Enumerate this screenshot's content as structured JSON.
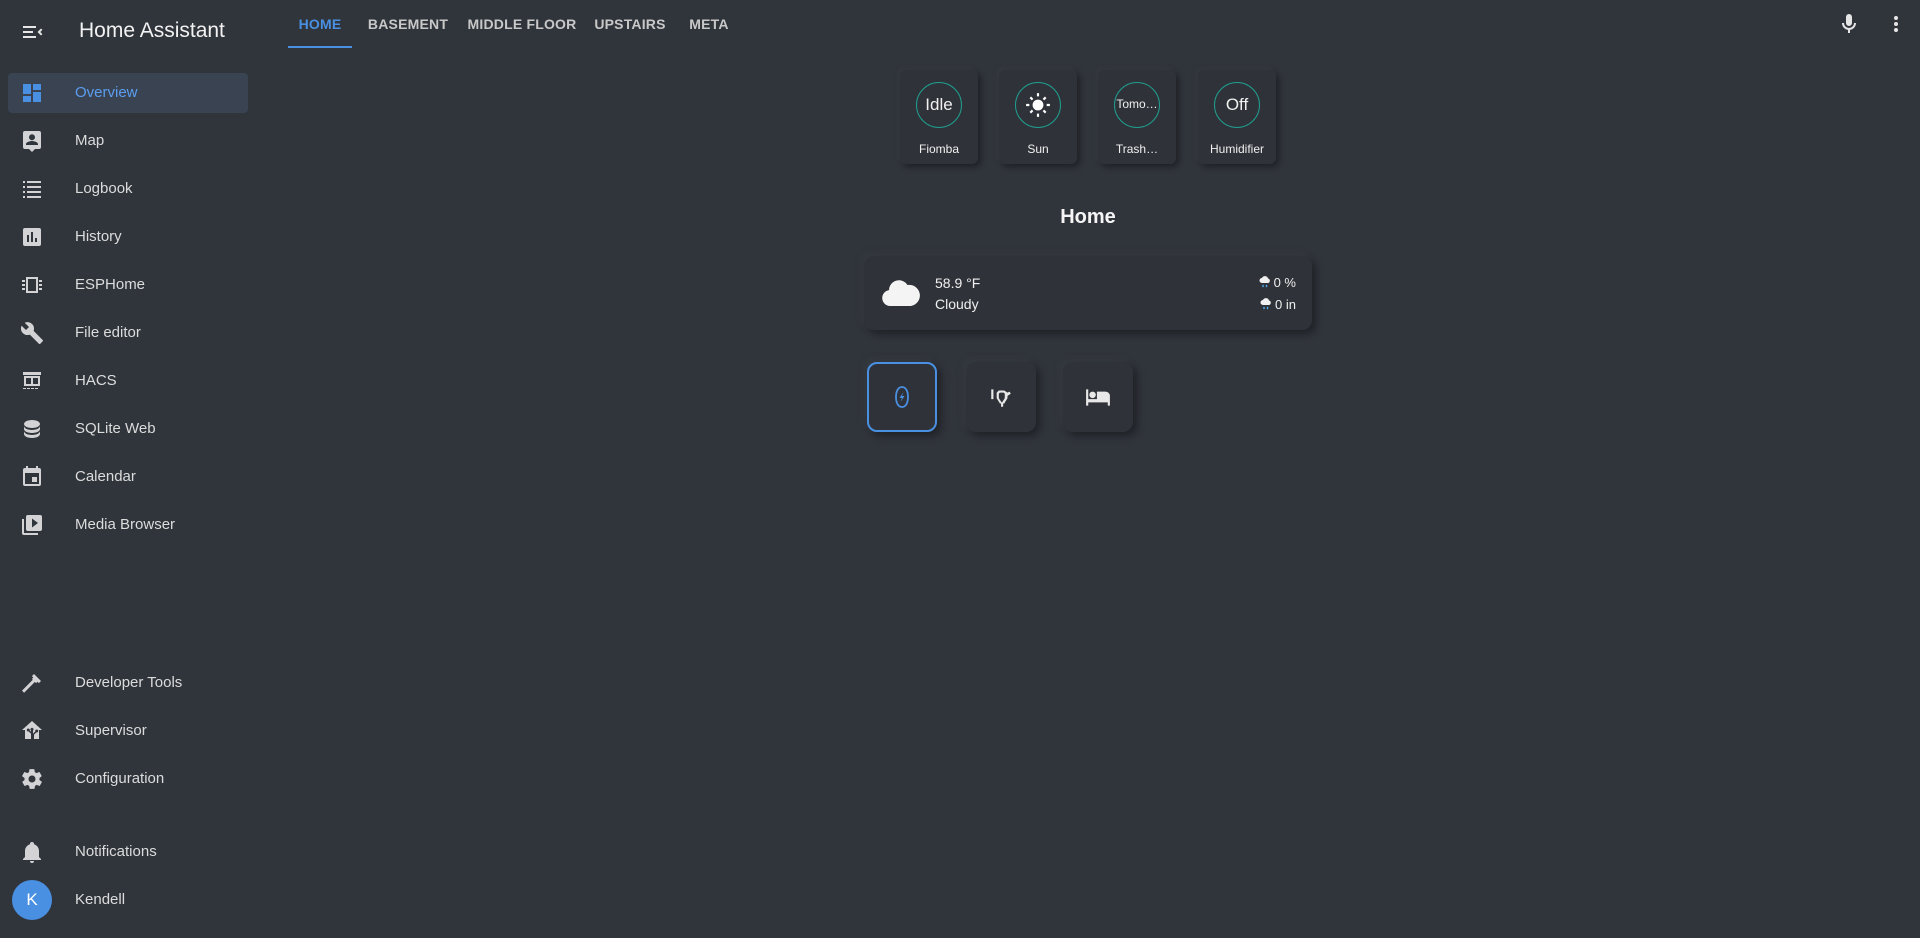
{
  "app": {
    "title": "Home Assistant"
  },
  "sidebar": {
    "items": [
      {
        "label": "Overview",
        "icon": "view-dashboard-icon",
        "selected": true
      },
      {
        "label": "Map",
        "icon": "map-account-icon"
      },
      {
        "label": "Logbook",
        "icon": "format-list-bulleted-icon"
      },
      {
        "label": "History",
        "icon": "chart-box-icon"
      },
      {
        "label": "ESPHome",
        "icon": "chip-icon"
      },
      {
        "label": "File editor",
        "icon": "wrench-icon"
      },
      {
        "label": "HACS",
        "icon": "hacs-store-icon"
      },
      {
        "label": "SQLite Web",
        "icon": "database-icon"
      },
      {
        "label": "Calendar",
        "icon": "calendar-icon"
      },
      {
        "label": "Media Browser",
        "icon": "play-box-multiple-icon"
      }
    ],
    "bottom_items": [
      {
        "label": "Developer Tools",
        "icon": "hammer-icon"
      },
      {
        "label": "Supervisor",
        "icon": "home-assistant-icon"
      },
      {
        "label": "Configuration",
        "icon": "cog-icon"
      }
    ],
    "notifications": {
      "label": "Notifications",
      "icon": "bell-icon"
    },
    "user": {
      "name": "Kendell",
      "initial": "K"
    }
  },
  "tabs": [
    {
      "label": "HOME",
      "active": true
    },
    {
      "label": "BASEMENT"
    },
    {
      "label": "MIDDLE FLOOR"
    },
    {
      "label": "UPSTAIRS"
    },
    {
      "label": "META"
    }
  ],
  "toolbar": {
    "voice_icon": "microphone-icon",
    "menu_icon": "dots-vertical-icon"
  },
  "badges": [
    {
      "value": "Idle",
      "label": "Fiomba"
    },
    {
      "value": "",
      "icon": "sun-icon",
      "label": "Sun"
    },
    {
      "value": "Tomo…",
      "label": "Trash…"
    },
    {
      "value": "Off",
      "label": "Humidifier"
    }
  ],
  "view": {
    "title": "Home"
  },
  "weather": {
    "temperature": "58.9 °F",
    "condition": "Cloudy",
    "precipitation_probability": "0 %",
    "precipitation": "0 in",
    "icon": "cloudy-icon"
  },
  "rooms": [
    {
      "name": "room-button-1",
      "icon": "leaf-oval-icon",
      "active": true
    },
    {
      "name": "room-button-2",
      "icon": "shower-icon"
    },
    {
      "name": "room-button-3",
      "icon": "bed-icon"
    }
  ],
  "colors": {
    "accent": "#4a90e2",
    "background": "#30343b",
    "ring": "#1f9e8f"
  }
}
